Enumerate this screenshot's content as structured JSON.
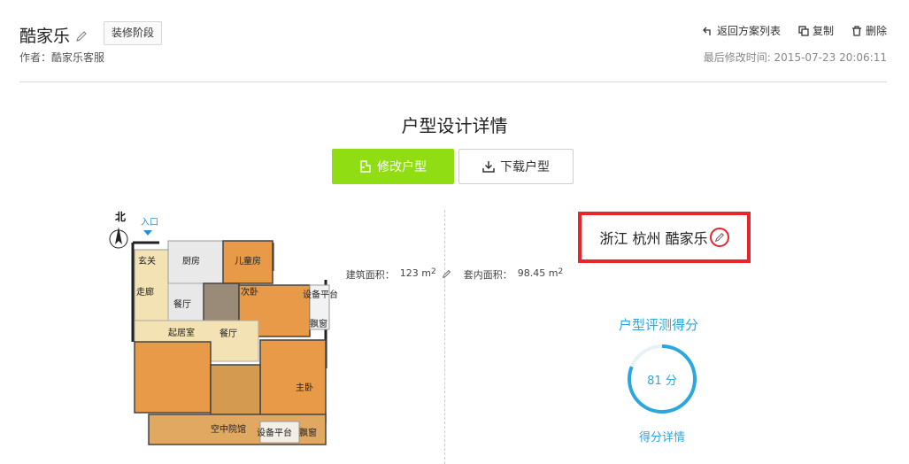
{
  "header": {
    "title": "酷家乐",
    "stage_button": "装修阶段",
    "author": "作者：酷家乐客服",
    "actions": {
      "back": "返回方案列表",
      "copy": "复制",
      "delete": "删除"
    },
    "modified": "最后修改时间:  2015-07-23 20:06:11"
  },
  "main": {
    "section_title": "户型设计详情",
    "edit_button": "修改户型",
    "download_button": "下载户型"
  },
  "floorplan": {
    "compass": "北",
    "entrance": "入口",
    "rooms": {
      "foyer": "玄关",
      "kitchen": "厨房",
      "kids_room": "儿童房",
      "corridor": "走廊",
      "dining": "餐厅",
      "second_bedroom": "次卧",
      "equipment_platform_1": "设备平台",
      "bay_window_1": "飘窗",
      "living_room": "起居室",
      "dining_2": "餐厅",
      "master_bedroom": "主卧",
      "sky_garden": "空中院馆",
      "equipment_platform_2": "设备平台",
      "bay_window_2": "飘窗"
    }
  },
  "details": {
    "location": "浙江 杭州 酷家乐",
    "building_area_label": "建筑面积：",
    "building_area_value": "123 m",
    "inner_area_label": "套内面积：",
    "inner_area_value": "98.45 m",
    "unit_sup": "2",
    "score_title": "户型评测得分",
    "score_text": "81 分",
    "score_value": 81,
    "score_detail": "得分详情"
  },
  "colors": {
    "accent_green": "#8fdd12",
    "score_blue": "#2ba7e0",
    "highlight_red": "#e8262a"
  }
}
